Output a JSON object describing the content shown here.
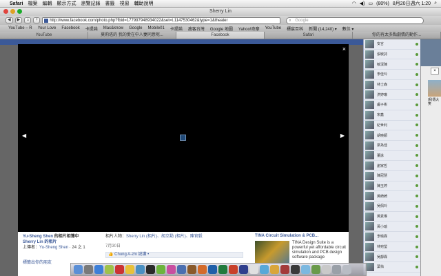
{
  "menubar": {
    "app": "Safari",
    "items": [
      "檔案",
      "編輯",
      "顯示方式",
      "瀏覽記錄",
      "書籤",
      "視窗",
      "輔助說明"
    ],
    "battery": "(80%)",
    "datetime": "8月20日週六 1:20"
  },
  "window": {
    "title": "Sherry Lin"
  },
  "toolbar": {
    "back": "◀",
    "forward": "▶",
    "home": "⌂",
    "add": "+",
    "url": "http://www.facebook.com/photo.php?fbid=177997948934022&set=t.1147530462&type=1&theater",
    "search_placeholder": "Google"
  },
  "bookmarks": [
    "YouTube – R",
    "Your Love",
    "Facebook",
    "卡提諾",
    "Mac&know",
    "Google",
    "Mobile01",
    "卡提諾",
    "痞客台灣",
    "Google 地圖",
    "Yahoo!奇摩",
    "YouTube",
    "標宸百科",
    "新聞 (14,240) ▾",
    "數位 ▾"
  ],
  "tabs": [
    {
      "label": "YouTube",
      "active": false
    },
    {
      "label": "莫莉塔的 我的愛在中人妻同意呢...",
      "active": false
    },
    {
      "label": "Facebook",
      "active": true
    },
    {
      "label": "Safari",
      "active": false
    },
    {
      "label": "你的有太多點劇情的動作...",
      "active": false
    }
  ],
  "viewer": {
    "close": "×",
    "prev": "◀",
    "next": "▶"
  },
  "caption": {
    "owner_line": "Yu-Sheng Shen 的相片相簿中",
    "owner_name": "Yu-Sheng Shen",
    "album_text": " 的相片相簿中",
    "person": "Sherry Lin 的相片",
    "uploader_prefix": "上傳者：",
    "uploader": "Yu-Sheng Shen",
    "count": " · 24 之 1",
    "more": "標籤出你的朋友",
    "tagged_prefix": "相片人物：",
    "tagged": "Sherry Lin (相片)、胡立勳 (相片)、陳官毅",
    "date": "7月30日",
    "like": "Chung A-zhi 說讚 •",
    "ad_title": "TINA Circuit Simulation & PCB...",
    "ad_body": "TINA Design Suite is a powerful yet affordable circuit simulation and PCB design software package"
  },
  "friends": [
    "安言",
    "張敏詩",
    "敏潔陳",
    "李佳玲",
    "林士森",
    "洪婷琳",
    "盧子彬",
    "宋鑫",
    "紀世利",
    "胡曉穎",
    "梁為佳",
    "董詠",
    "謝家哲",
    "陳冠慧",
    "陳玉婷",
    "黃綺綺",
    "吳佩玲",
    "黃素琳",
    "黃小瑜",
    "李曉霖",
    "林宛瑩",
    "吳靜霖",
    "葉佑"
  ],
  "rightwin": {
    "close": "×",
    "text": "|我傳大\n笑"
  }
}
